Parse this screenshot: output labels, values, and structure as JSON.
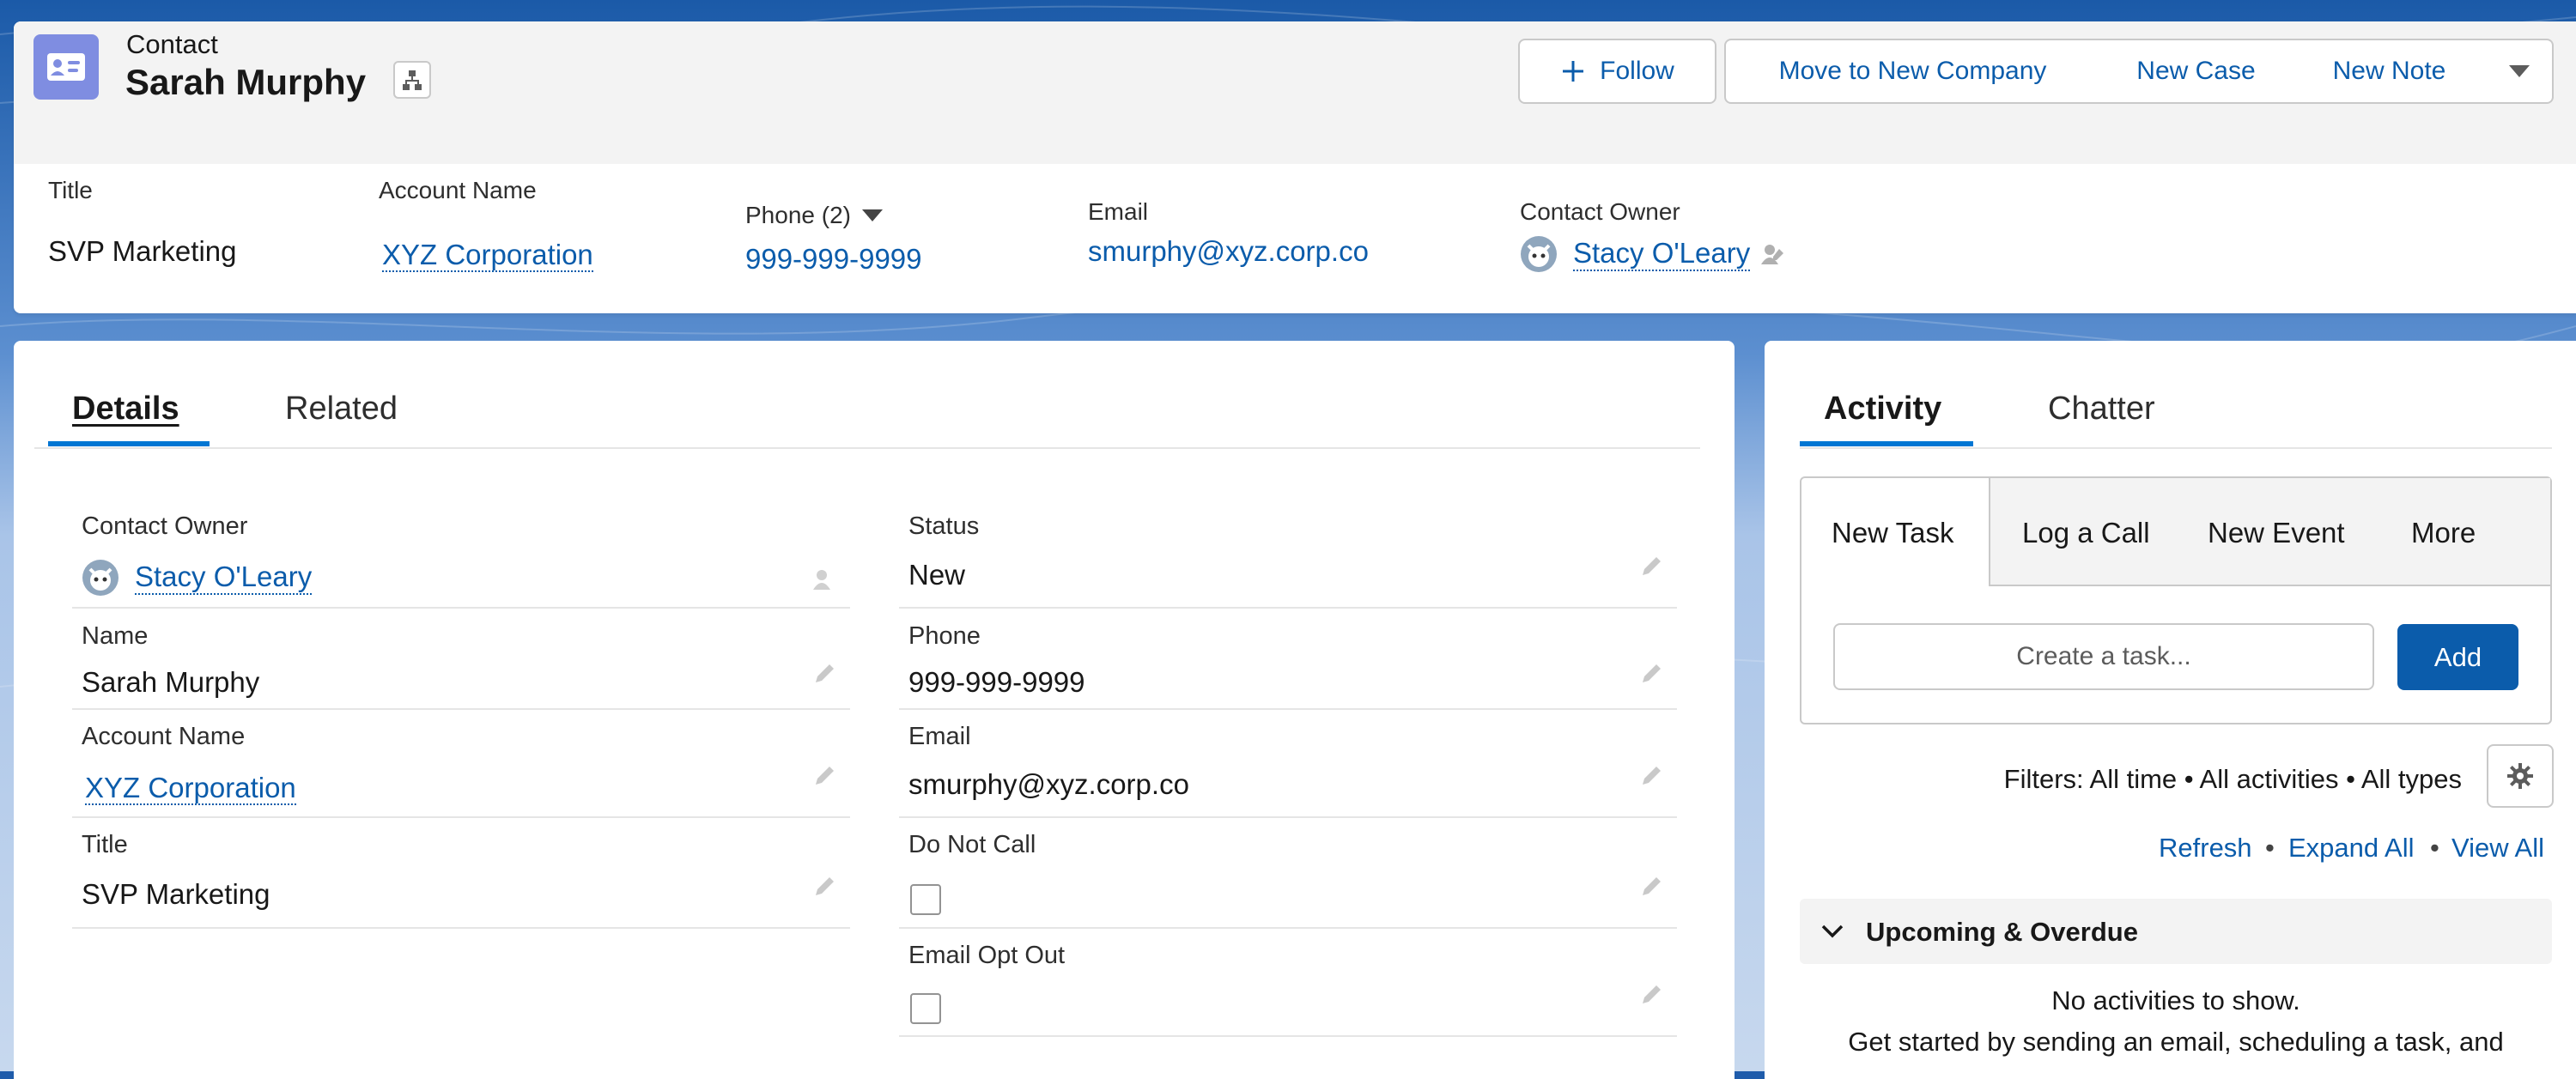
{
  "header": {
    "object_type": "Contact",
    "record_name": "Sarah Murphy",
    "actions": {
      "follow": "Follow",
      "move": "Move to New Company",
      "new_case": "New Case",
      "new_note": "New Note"
    },
    "highlights": {
      "title_label": "Title",
      "title_value": "SVP Marketing",
      "account_label": "Account Name",
      "account_value": "XYZ Corporation",
      "phone_label": "Phone (2)",
      "phone_value": "999-999-9999",
      "email_label": "Email",
      "email_value": "smurphy@xyz.corp.co",
      "owner_label": "Contact Owner",
      "owner_value": "Stacy O'Leary"
    }
  },
  "details": {
    "tabs": [
      "Details",
      "Related"
    ],
    "active_tab": "Details",
    "left": {
      "owner_label": "Contact Owner",
      "owner_value": "Stacy O'Leary",
      "name_label": "Name",
      "name_value": "Sarah Murphy",
      "account_label": "Account Name",
      "account_value": "XYZ Corporation",
      "title_label": "Title",
      "title_value": "SVP Marketing"
    },
    "right": {
      "status_label": "Status",
      "status_value": "New",
      "phone_label": "Phone",
      "phone_value": "999-999-9999",
      "email_label": "Email",
      "email_value": "smurphy@xyz.corp.co",
      "dnc_label": "Do Not Call",
      "dnc_checked": false,
      "optout_label": "Email Opt Out",
      "optout_checked": false
    }
  },
  "activity": {
    "tabs": [
      "Activity",
      "Chatter"
    ],
    "active_tab": "Activity",
    "composer_tabs": [
      "New Task",
      "Log a Call",
      "New Event",
      "More"
    ],
    "active_composer_tab": "New Task",
    "task_placeholder": "Create a task...",
    "add_label": "Add",
    "filters": "Filters: All time • All activities • All types",
    "links": [
      "Refresh",
      "Expand All",
      "View All"
    ],
    "section_title": "Upcoming & Overdue",
    "empty_title": "No activities to show.",
    "empty_body": "Get started by sending an email, scheduling a task, and"
  },
  "colors": {
    "brand_blue": "#0b5cab",
    "contact_icon": "#7f8de1",
    "background": "#1f5cab"
  },
  "icons": [
    "contact-card-icon",
    "hierarchy-icon",
    "plus-icon",
    "chevron-down-icon",
    "avatar-icon",
    "owner-change-icon",
    "pencil-icon",
    "gear-icon",
    "caret-down-icon"
  ]
}
